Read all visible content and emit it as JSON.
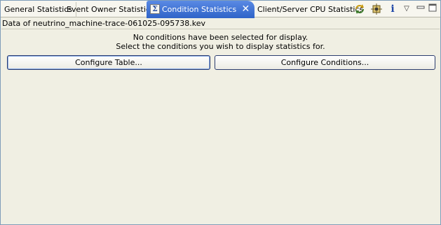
{
  "tabs": [
    {
      "label": "General Statistics",
      "active": false
    },
    {
      "label": "Event Owner Statistics",
      "active": false
    },
    {
      "label": "Condition Statistics",
      "active": true
    },
    {
      "label": "Client/Server CPU Statistics",
      "active": false
    }
  ],
  "active_tab_icon": "sigma-icon",
  "toolbar": {
    "icons": [
      "sync-icon",
      "configure-icon",
      "info-icon",
      "view-menu-icon",
      "minimize-icon",
      "maximize-icon"
    ]
  },
  "view": {
    "data_label": "Data of neutrino_machine-trace-061025-095738.kev",
    "message_line1": "No conditions have been selected for display.",
    "message_line2": "Select the conditions you wish to display statistics for.",
    "configure_table_label": "Configure Table...",
    "configure_conditions_label": "Configure Conditions..."
  },
  "colors": {
    "active_tab": "#3a6fd0",
    "panel_background": "#f0efe3"
  }
}
